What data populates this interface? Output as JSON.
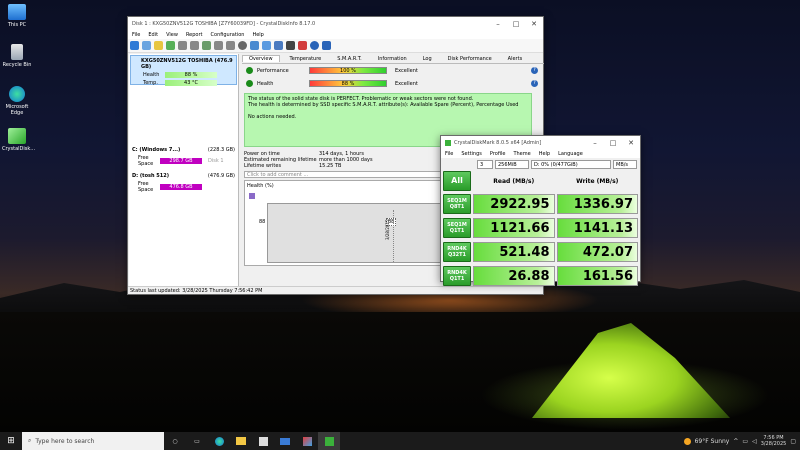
{
  "desktop": {
    "icons": [
      {
        "label": "This PC"
      },
      {
        "label": "Recycle Bin"
      },
      {
        "label": "Microsoft Edge"
      },
      {
        "label": "CrystalDisk..."
      }
    ]
  },
  "cdi": {
    "title": "Disk 1 : KXG50ZNV512G TOSHIBA [Z7Y60039FD] - CrystalDiskInfo 8.17.0",
    "menu": [
      "File",
      "Edit",
      "View",
      "Report",
      "Configuration",
      "Help"
    ],
    "disk": {
      "name": "KXG50ZNV512G TOSHIBA (476.9 GB)",
      "health_label": "Health",
      "health_value": "88 %",
      "temp_label": "Temp.",
      "temp_value": "43 °C"
    },
    "volumes": [
      {
        "name": "C: (Windows 7...)",
        "size": "(228.3 GB)",
        "free_label": "Free Space",
        "free_value": "298.7 GB",
        "extra": "Disk 1"
      },
      {
        "name": "D: (tosh 512)",
        "size": "(476.9 GB)",
        "free_label": "Free Space",
        "free_value": "476.8 GB",
        "extra": ""
      }
    ],
    "tabs": [
      "Overview",
      "Temperature",
      "S.M.A.R.T.",
      "Information",
      "Log",
      "Disk Performance",
      "Alerts"
    ],
    "performance": {
      "label": "Performance",
      "value": "100 %",
      "status": "Excellent"
    },
    "health": {
      "label": "Health",
      "value": "88 %",
      "status": "Excellent"
    },
    "message_line1": "The status of the solid state disk is PERFECT. Problematic or weak sectors were not found.",
    "message_line2": "The health is determined by SSD specific S.M.A.R.T. attribute(s): Available Spare (Percent), Percentage Used",
    "message_line3": "No actions needed.",
    "info": [
      {
        "k": "Power on time",
        "v": "314 days, 1 hours"
      },
      {
        "k": "Estimated remaining lifetime",
        "v": "more than 1000 days"
      },
      {
        "k": "Lifetime writes",
        "v": "15.25 TB"
      }
    ],
    "comment_placeholder": "Click to add comment ...",
    "chart_title": "Health (%)",
    "chart_yval": "88",
    "chart_point": "88",
    "chart_date": "3/28/2025",
    "status": "Status last updated: 3/28/2025 Thursday 7:56:42 PM"
  },
  "cdm": {
    "title": "CrystalDiskMark 8.0.5 x64 [Admin]",
    "menu": [
      "File",
      "Settings",
      "Profile",
      "Theme",
      "Help",
      "Language"
    ],
    "count": "3",
    "size": "256MiB",
    "drive": "D: 0% (0/477GiB)",
    "unit": "MB/s",
    "all_label": "All",
    "read_header": "Read (MB/s)",
    "write_header": "Write (MB/s)",
    "rows": [
      {
        "l1": "SEQ1M",
        "l2": "Q8T1",
        "read": "2922.95",
        "write": "1336.97"
      },
      {
        "l1": "SEQ1M",
        "l2": "Q1T1",
        "read": "1121.66",
        "write": "1141.13"
      },
      {
        "l1": "RND4K",
        "l2": "Q32T1",
        "read": "521.48",
        "write": "472.07"
      },
      {
        "l1": "RND4K",
        "l2": "Q1T1",
        "read": "26.88",
        "write": "161.56"
      }
    ]
  },
  "taskbar": {
    "search_placeholder": "Type here to search",
    "weather": "69°F Sunny",
    "time": "7:56 PM",
    "date": "3/28/2025"
  }
}
